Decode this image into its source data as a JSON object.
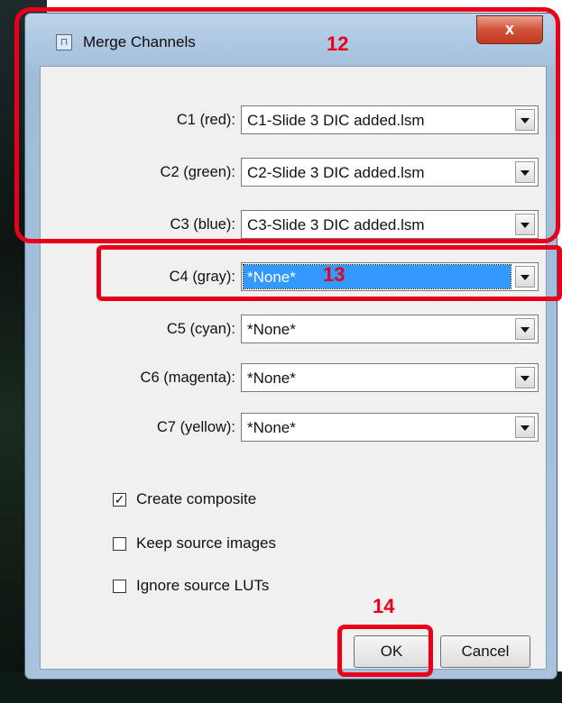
{
  "window": {
    "title": "Merge Channels",
    "close_glyph": "x"
  },
  "channels": [
    {
      "label": "C1 (red):",
      "value": "C1-Slide 3 DIC added.lsm"
    },
    {
      "label": "C2 (green):",
      "value": "C2-Slide 3 DIC added.lsm"
    },
    {
      "label": "C3 (blue):",
      "value": "C3-Slide 3 DIC added.lsm"
    },
    {
      "label": "C4 (gray):",
      "value": "*None*"
    },
    {
      "label": "C5 (cyan):",
      "value": "*None*"
    },
    {
      "label": "C6 (magenta):",
      "value": "*None*"
    },
    {
      "label": "C7 (yellow):",
      "value": "*None*"
    }
  ],
  "options": [
    {
      "label": "Create composite",
      "checked": true,
      "mark": "✓"
    },
    {
      "label": "Keep source images",
      "checked": false,
      "mark": ""
    },
    {
      "label": "Ignore source LUTs",
      "checked": false,
      "mark": ""
    }
  ],
  "buttons": {
    "ok": "OK",
    "cancel": "Cancel"
  },
  "annotations": {
    "a12": "12",
    "a13": "13",
    "a14": "14"
  },
  "colors": {
    "highlight": "#e8001a",
    "selection": "#3399ff"
  }
}
